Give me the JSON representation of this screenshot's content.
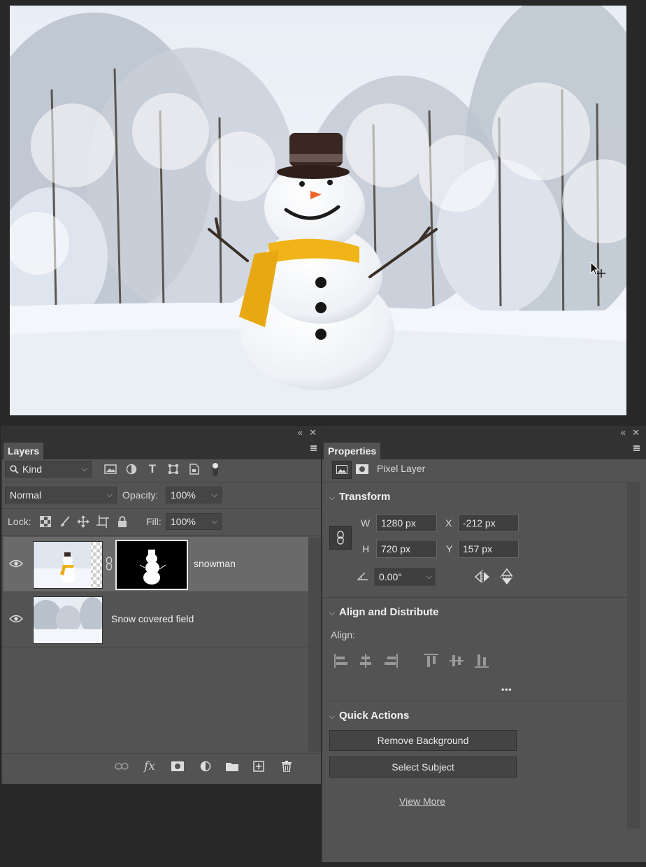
{
  "layers_panel": {
    "tab": "Layers",
    "filter": {
      "selected": "Kind"
    },
    "blend_mode": "Normal",
    "opacity_label": "Opacity:",
    "opacity_value": "100%",
    "lock_label": "Lock:",
    "fill_label": "Fill:",
    "fill_value": "100%",
    "layers": [
      {
        "name": "snowman",
        "visible": true,
        "selected": true,
        "has_mask": true
      },
      {
        "name": "Snow covered field",
        "visible": true,
        "selected": false,
        "has_mask": false
      }
    ]
  },
  "properties_panel": {
    "tab": "Properties",
    "layer_type": "Pixel Layer",
    "transform": {
      "title": "Transform",
      "w_label": "W",
      "w_value": "1280 px",
      "h_label": "H",
      "h_value": "720 px",
      "x_label": "X",
      "x_value": "-212 px",
      "y_label": "Y",
      "y_value": "157 px",
      "angle_value": "0.00°"
    },
    "align": {
      "title": "Align and Distribute",
      "align_label": "Align:",
      "more": "•••"
    },
    "quick_actions": {
      "title": "Quick Actions",
      "remove_background": "Remove Background",
      "select_subject": "Select Subject",
      "view_more": "View More"
    }
  },
  "colors": {
    "panel_bg": "#535353",
    "workspace_bg": "#282828",
    "selected_row": "#6a6a6a"
  }
}
